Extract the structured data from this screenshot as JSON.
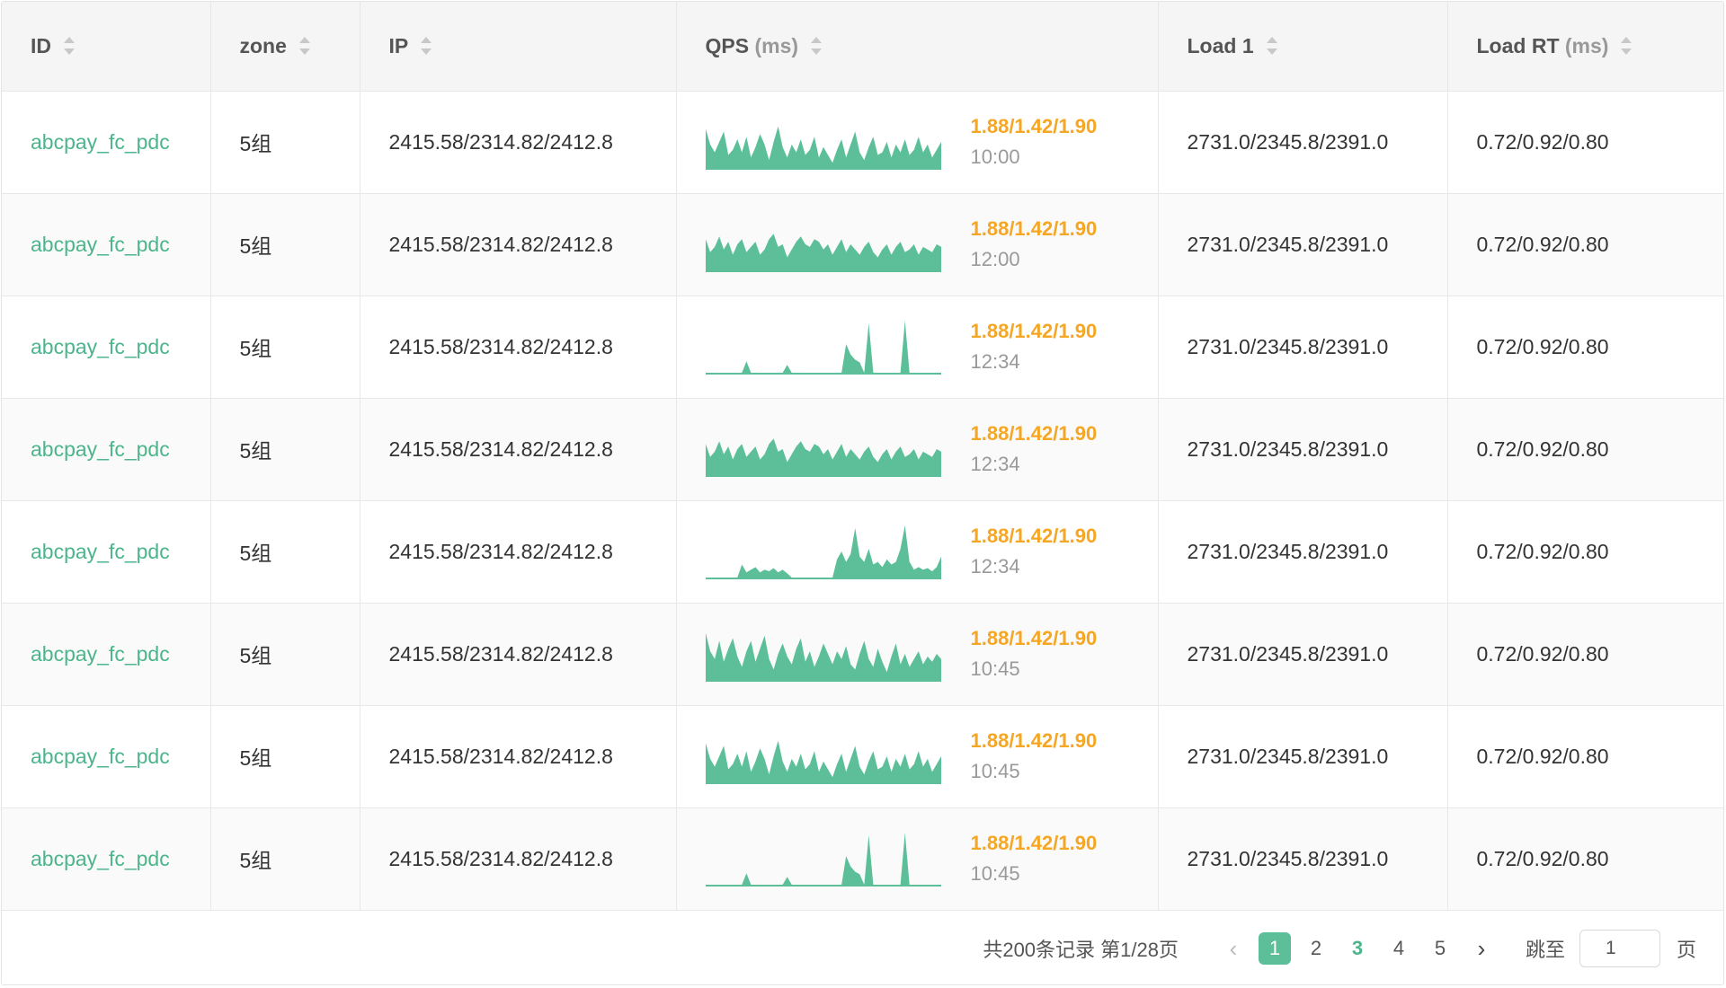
{
  "columns": [
    {
      "label": "ID",
      "unit": ""
    },
    {
      "label": "zone",
      "unit": ""
    },
    {
      "label": "IP",
      "unit": ""
    },
    {
      "label": "QPS",
      "unit": "(ms)"
    },
    {
      "label": "Load 1",
      "unit": ""
    },
    {
      "label": "Load RT",
      "unit": "(ms)"
    }
  ],
  "rows": [
    {
      "id": "abcpay_fc_pdc",
      "zone": "5组",
      "ip": "2415.58/2314.82/2412.8",
      "qps": "1.88/1.42/1.90",
      "time": "10:00",
      "load1": "2731.0/2345.8/2391.0",
      "load_rt": "0.72/0.92/0.80",
      "spark": "a"
    },
    {
      "id": "abcpay_fc_pdc",
      "zone": "5组",
      "ip": "2415.58/2314.82/2412.8",
      "qps": "1.88/1.42/1.90",
      "time": "12:00",
      "load1": "2731.0/2345.8/2391.0",
      "load_rt": "0.72/0.92/0.80",
      "spark": "b"
    },
    {
      "id": "abcpay_fc_pdc",
      "zone": "5组",
      "ip": "2415.58/2314.82/2412.8",
      "qps": "1.88/1.42/1.90",
      "time": "12:34",
      "load1": "2731.0/2345.8/2391.0",
      "load_rt": "0.72/0.92/0.80",
      "spark": "c"
    },
    {
      "id": "abcpay_fc_pdc",
      "zone": "5组",
      "ip": "2415.58/2314.82/2412.8",
      "qps": "1.88/1.42/1.90",
      "time": "12:34",
      "load1": "2731.0/2345.8/2391.0",
      "load_rt": "0.72/0.92/0.80",
      "spark": "b"
    },
    {
      "id": "abcpay_fc_pdc",
      "zone": "5组",
      "ip": "2415.58/2314.82/2412.8",
      "qps": "1.88/1.42/1.90",
      "time": "12:34",
      "load1": "2731.0/2345.8/2391.0",
      "load_rt": "0.72/0.92/0.80",
      "spark": "d"
    },
    {
      "id": "abcpay_fc_pdc",
      "zone": "5组",
      "ip": "2415.58/2314.82/2412.8",
      "qps": "1.88/1.42/1.90",
      "time": "10:45",
      "load1": "2731.0/2345.8/2391.0",
      "load_rt": "0.72/0.92/0.80",
      "spark": "e"
    },
    {
      "id": "abcpay_fc_pdc",
      "zone": "5组",
      "ip": "2415.58/2314.82/2412.8",
      "qps": "1.88/1.42/1.90",
      "time": "10:45",
      "load1": "2731.0/2345.8/2391.0",
      "load_rt": "0.72/0.92/0.80",
      "spark": "a"
    },
    {
      "id": "abcpay_fc_pdc",
      "zone": "5组",
      "ip": "2415.58/2314.82/2412.8",
      "qps": "1.88/1.42/1.90",
      "time": "10:45",
      "load1": "2731.0/2345.8/2391.0",
      "load_rt": "0.72/0.92/0.80",
      "spark": "c"
    }
  ],
  "sparklines": {
    "color": "#5cbf9a",
    "a": [
      0.75,
      0.45,
      0.3,
      0.5,
      0.7,
      0.25,
      0.35,
      0.55,
      0.3,
      0.6,
      0.2,
      0.4,
      0.65,
      0.45,
      0.15,
      0.5,
      0.8,
      0.4,
      0.2,
      0.45,
      0.3,
      0.55,
      0.25,
      0.35,
      0.6,
      0.2,
      0.4,
      0.25,
      0.1,
      0.35,
      0.55,
      0.2,
      0.45,
      0.7,
      0.3,
      0.15,
      0.4,
      0.6,
      0.25,
      0.3,
      0.5,
      0.2,
      0.45,
      0.3,
      0.55,
      0.25,
      0.35,
      0.6,
      0.3,
      0.45,
      0.2,
      0.35,
      0.5
    ],
    "b": [
      0.6,
      0.35,
      0.45,
      0.65,
      0.4,
      0.55,
      0.3,
      0.5,
      0.6,
      0.35,
      0.45,
      0.55,
      0.3,
      0.4,
      0.6,
      0.7,
      0.45,
      0.5,
      0.25,
      0.4,
      0.55,
      0.65,
      0.5,
      0.45,
      0.6,
      0.55,
      0.4,
      0.5,
      0.3,
      0.45,
      0.6,
      0.35,
      0.5,
      0.4,
      0.3,
      0.45,
      0.55,
      0.35,
      0.25,
      0.4,
      0.5,
      0.3,
      0.45,
      0.55,
      0.35,
      0.4,
      0.5,
      0.3,
      0.45,
      0.4,
      0.35,
      0.5,
      0.45
    ],
    "c": [
      0,
      0,
      0,
      0,
      0,
      0,
      0,
      0,
      0,
      0.22,
      0,
      0,
      0,
      0,
      0,
      0,
      0,
      0,
      0.15,
      0,
      0,
      0,
      0,
      0,
      0,
      0,
      0,
      0,
      0,
      0,
      0,
      0.55,
      0.35,
      0.25,
      0.2,
      0,
      0.95,
      0,
      0,
      0,
      0,
      0,
      0,
      0,
      1.0,
      0,
      0,
      0,
      0,
      0,
      0,
      0,
      0
    ],
    "d": [
      0,
      0,
      0,
      0,
      0,
      0,
      0,
      0,
      0.25,
      0.1,
      0.15,
      0.2,
      0.1,
      0.15,
      0.12,
      0.18,
      0.1,
      0.15,
      0.08,
      0,
      0,
      0,
      0,
      0,
      0,
      0,
      0,
      0,
      0,
      0.35,
      0.5,
      0.3,
      0.45,
      0.95,
      0.4,
      0.3,
      0.55,
      0.25,
      0.3,
      0.2,
      0.35,
      0.25,
      0.3,
      0.55,
      1.0,
      0.3,
      0.15,
      0.2,
      0.15,
      0.18,
      0.12,
      0.2,
      0.4
    ],
    "e": [
      0.9,
      0.55,
      0.4,
      0.75,
      0.35,
      0.6,
      0.8,
      0.45,
      0.25,
      0.55,
      0.75,
      0.35,
      0.6,
      0.85,
      0.4,
      0.2,
      0.5,
      0.7,
      0.45,
      0.3,
      0.6,
      0.8,
      0.35,
      0.55,
      0.25,
      0.45,
      0.7,
      0.5,
      0.3,
      0.55,
      0.4,
      0.65,
      0.3,
      0.2,
      0.5,
      0.75,
      0.4,
      0.25,
      0.6,
      0.35,
      0.15,
      0.45,
      0.7,
      0.3,
      0.5,
      0.25,
      0.4,
      0.55,
      0.3,
      0.45,
      0.35,
      0.5,
      0.4
    ]
  },
  "footer": {
    "total": "共200条记录 第1/28页",
    "pages": [
      "1",
      "2",
      "3",
      "4",
      "5"
    ],
    "current_page": "1",
    "highlight_page": "3",
    "jump_label": "跳至",
    "jump_value": "1",
    "jump_unit": "页"
  }
}
